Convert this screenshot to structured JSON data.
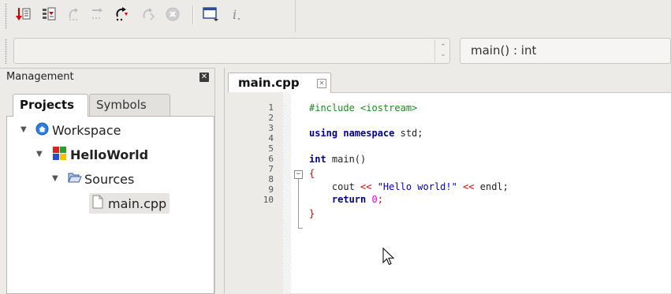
{
  "toolbar": {
    "icons": [
      "run-to-cursor-icon",
      "next-line-icon",
      "step-into-icon",
      "step-out-icon",
      "next-instruction-icon",
      "step-into-instruction-icon",
      "stop-debugger-icon",
      "debugging-windows-icon",
      "information-icon"
    ]
  },
  "scope_bar": {
    "scope_value": "",
    "function_value": "main() : int"
  },
  "management": {
    "title": "Management",
    "tabs": [
      {
        "label": "Projects",
        "active": true
      },
      {
        "label": "Symbols",
        "active": false
      }
    ],
    "tree": {
      "workspace": "Workspace",
      "project": "HelloWorld",
      "folder": "Sources",
      "file": "main.cpp"
    }
  },
  "editor": {
    "tab_label": "main.cpp",
    "line_numbers": [
      "1",
      "2",
      "3",
      "4",
      "5",
      "6",
      "7",
      "8",
      "9",
      "10"
    ],
    "code": {
      "l1": "#include <iostream>",
      "l3_kw": "using namespace",
      "l3_rest": " std;",
      "l5_kw": "int",
      "l5_rest": " main()",
      "l6": "{",
      "l7_a": "    cout ",
      "l7_op1": "<<",
      "l7_str": " \"Hello world!\" ",
      "l7_op2": "<<",
      "l7_b": " endl;",
      "l8_kw": "    return",
      "l8_num": " 0",
      "l8_end": ";",
      "l9": "}"
    }
  },
  "colors": {
    "keyword": "#00008b",
    "preprocessor": "#1c8a1c",
    "string": "#0000c0",
    "operator": "#e00000",
    "number": "#e000e0"
  }
}
